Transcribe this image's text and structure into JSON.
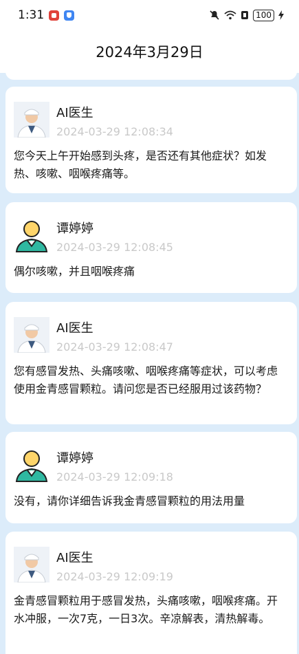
{
  "status": {
    "time": "1:31",
    "battery": "100"
  },
  "header": {
    "title": "2024年3月29日"
  },
  "messages": [
    {
      "role": "doctor",
      "name": "AI医生",
      "time": "2024-03-29 12:08:34",
      "text": "您今天上午开始感到头疼，是否还有其他症状？如发热、咳嗽、咽喉疼痛等。"
    },
    {
      "role": "user",
      "name": "谭婷婷",
      "time": "2024-03-29 12:08:45",
      "text": "偶尔咳嗽，并且咽喉疼痛"
    },
    {
      "role": "doctor",
      "name": "AI医生",
      "time": "2024-03-29 12:08:47",
      "text": "您有感冒发热、头痛咳嗽、咽喉疼痛等症状，可以考虑使用金青感冒颗粒。请问您是否已经服用过该药物？"
    },
    {
      "role": "user",
      "name": "谭婷婷",
      "time": "2024-03-29 12:09:18",
      "text": "没有，请你详细告诉我金青感冒颗粒的用法用量"
    },
    {
      "role": "doctor",
      "name": "AI医生",
      "time": "2024-03-29 12:09:19",
      "text": "金青感冒颗粒用于感冒发热，头痛咳嗽，咽喉疼痛。开水冲服，一次7克，一日3次。辛凉解表，清热解毒。"
    }
  ]
}
